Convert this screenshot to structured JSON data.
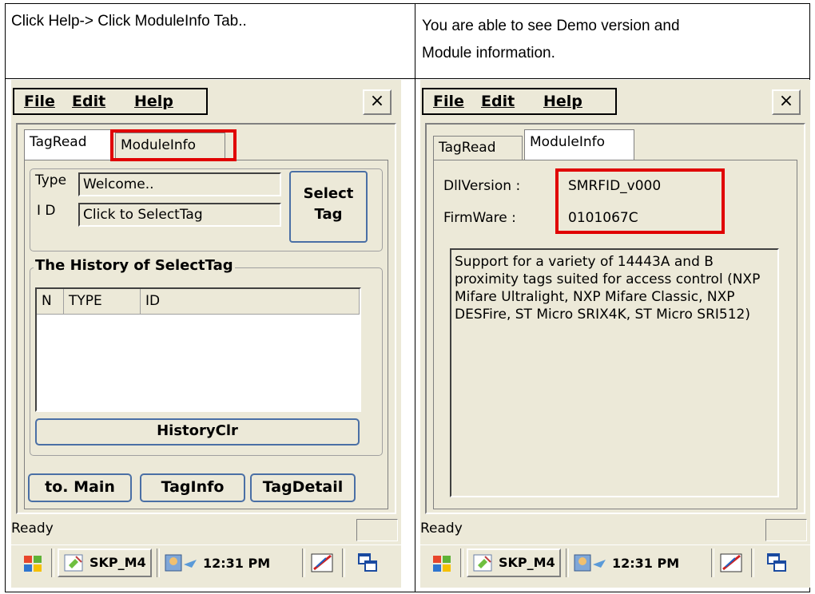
{
  "captions": {
    "left": "Click Help-> Click ModuleInfo Tab..",
    "right_line1": "You are able to see Demo version and",
    "right_line2": "Module information."
  },
  "menu": {
    "file": "File",
    "edit": "Edit",
    "help": "Help",
    "close": "×"
  },
  "tabs": {
    "tagread": "TagRead",
    "moduleinfo": "ModuleInfo"
  },
  "tagread_panel": {
    "type_label": "Type",
    "type_value": "Welcome..",
    "id_label": "I D",
    "id_value": "Click to SelectTag",
    "select_button_line1": "Select",
    "select_button_line2": "Tag",
    "history_title": "The History of SelectTag",
    "columns": [
      "N",
      "TYPE",
      "ID"
    ],
    "history_clear": "HistoryClr",
    "to_main": "to. Main",
    "tag_info": "TagInfo",
    "tag_detail": "TagDetail"
  },
  "moduleinfo_panel": {
    "dll_label": "DllVersion :",
    "dll_value": "SMRFID_v000",
    "fw_label": "FirmWare :",
    "fw_value": "0101067C",
    "description": "Support for a variety of 14443A and B proximity tags suited for access control  (NXP Mifare Ultralight, NXP Mifare Classic, NXP DESFire, ST Micro SRIX4K, ST Micro SRI512)"
  },
  "status": {
    "text": "Ready"
  },
  "taskbar": {
    "app": "SKP_M4",
    "time": "12:31 PM",
    "icons": [
      "start-flag-icon",
      "app-icon",
      "network-icon",
      "pen-icon",
      "windows-switch-icon"
    ]
  },
  "colors": {
    "highlight": "#e00000",
    "window_bg": "#ece9d8",
    "button_border": "#4a6fa5"
  }
}
